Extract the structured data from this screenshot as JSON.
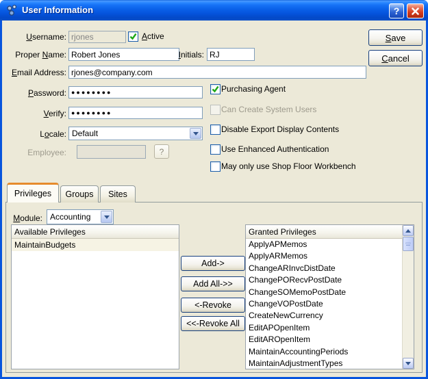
{
  "window": {
    "title": "User Information",
    "help": "?"
  },
  "header_buttons": {
    "save": "[S]ave",
    "cancel": "[C]ancel"
  },
  "fields": {
    "username": {
      "label": "[U]sername:",
      "value": "rjones"
    },
    "active": {
      "label": "[A]ctive",
      "checked": true
    },
    "proper_name": {
      "label": "Proper [N]ame:",
      "value": "Robert Jones"
    },
    "initials": {
      "label": "[I]nitials:",
      "value": "RJ"
    },
    "email": {
      "label": "[E]mail Address:",
      "value": "rjones@company.com"
    },
    "password": {
      "label": "[P]assword:",
      "value": "●●●●●●●●"
    },
    "verify": {
      "label": "[V]erify:",
      "value": "●●●●●●●●"
    },
    "locale": {
      "label": "L[o]cale:",
      "value": "Default"
    },
    "employee": {
      "label": "Employee:",
      "value": "",
      "lookup": "?"
    }
  },
  "checkboxes": {
    "purchasing_agent": {
      "label": "Purchasing Agent",
      "checked": true,
      "enabled": true
    },
    "can_create_system_users": {
      "label": "Can Create System Users",
      "checked": false,
      "enabled": false
    },
    "disable_export": {
      "label": "Disable Export Display Contents",
      "checked": false,
      "enabled": true
    },
    "enhanced_auth": {
      "label": "Use Enhanced Authentication",
      "checked": false,
      "enabled": true
    },
    "shop_floor_only": {
      "label": "May only use Shop Floor Workbench",
      "checked": false,
      "enabled": true
    }
  },
  "tabs": {
    "privileges": "Privileges",
    "groups": "Groups",
    "sites": "Sites",
    "active_tab": "Privileges"
  },
  "module": {
    "label": "[M]odule:",
    "value": "Accounting"
  },
  "available": {
    "header": "Available Privileges",
    "items": [
      "MaintainBudgets"
    ]
  },
  "granted": {
    "header": "Granted Privileges",
    "items": [
      "ApplyAPMemos",
      "ApplyARMemos",
      "ChangeARInvcDistDate",
      "ChangePORecvPostDate",
      "ChangeSOMemoPostDate",
      "ChangeVOPostDate",
      "CreateNewCurrency",
      "EditAPOpenItem",
      "EditAROpenItem",
      "MaintainAccountingPeriods",
      "MaintainAdjustmentTypes"
    ]
  },
  "actions": {
    "add": "Add->",
    "add_all": "Add All->>",
    "revoke": "<-Revoke",
    "revoke_all": "<<-Revoke All"
  },
  "colors": {
    "titlebar_blue": "#0a60e8",
    "border_blue": "#0855dd",
    "check_green": "#1ea817",
    "close_red": "#d23a1d",
    "tab_accent_orange": "#e68b2c",
    "selected_row_cream": "#f6f3e4",
    "dialog_beige": "#ece9d8"
  }
}
